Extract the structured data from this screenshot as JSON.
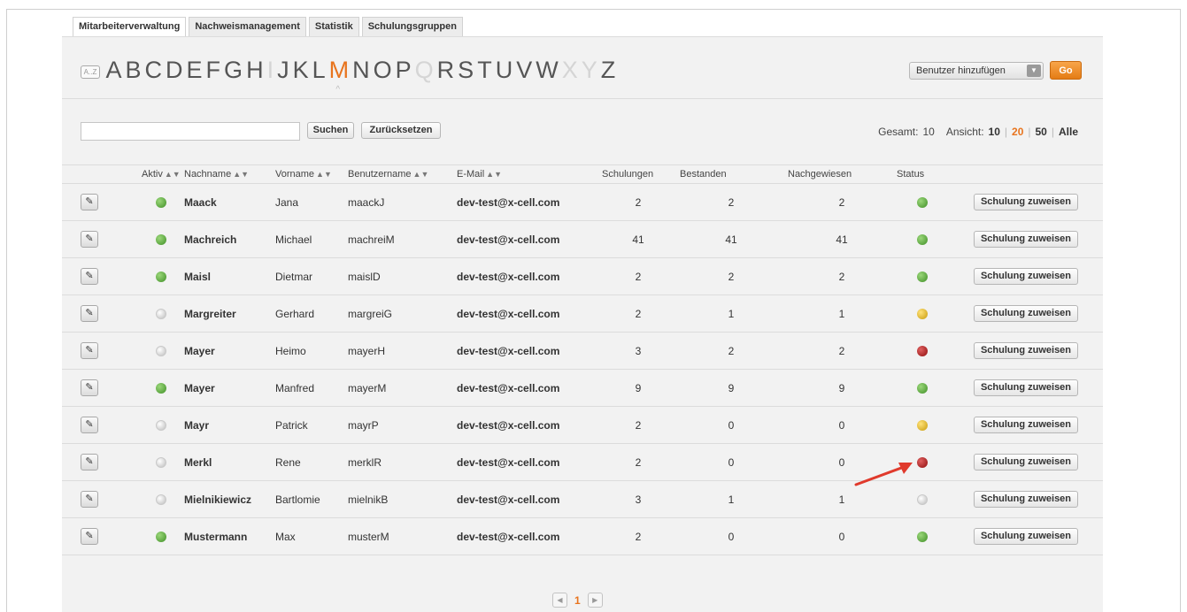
{
  "tabs": [
    "Mitarbeiterverwaltung",
    "Nachweismanagement",
    "Statistik",
    "Schulungsgruppen"
  ],
  "alphabet": {
    "az_icon": "A..Z",
    "letters": [
      {
        "l": "A",
        "state": "normal"
      },
      {
        "l": "B",
        "state": "normal"
      },
      {
        "l": "C",
        "state": "normal"
      },
      {
        "l": "D",
        "state": "normal"
      },
      {
        "l": "E",
        "state": "normal"
      },
      {
        "l": "F",
        "state": "normal"
      },
      {
        "l": "G",
        "state": "normal"
      },
      {
        "l": "H",
        "state": "normal"
      },
      {
        "l": "I",
        "state": "dim"
      },
      {
        "l": "J",
        "state": "normal"
      },
      {
        "l": "K",
        "state": "normal"
      },
      {
        "l": "L",
        "state": "normal"
      },
      {
        "l": "M",
        "state": "selected"
      },
      {
        "l": "N",
        "state": "normal"
      },
      {
        "l": "O",
        "state": "normal"
      },
      {
        "l": "P",
        "state": "normal"
      },
      {
        "l": "Q",
        "state": "dim"
      },
      {
        "l": "R",
        "state": "normal"
      },
      {
        "l": "S",
        "state": "normal"
      },
      {
        "l": "T",
        "state": "normal"
      },
      {
        "l": "U",
        "state": "normal"
      },
      {
        "l": "V",
        "state": "normal"
      },
      {
        "l": "W",
        "state": "normal"
      },
      {
        "l": "X",
        "state": "dim"
      },
      {
        "l": "Y",
        "state": "dim"
      },
      {
        "l": "Z",
        "state": "normal"
      }
    ]
  },
  "actions": {
    "add_user_select": "Benutzer hinzufügen",
    "go_label": "Go"
  },
  "search": {
    "placeholder": "",
    "search_label": "Suchen",
    "reset_label": "Zurücksetzen"
  },
  "paging": {
    "total_label": "Gesamt:",
    "total": "10",
    "view_label": "Ansicht:",
    "options": [
      "10",
      "20",
      "50",
      "Alle"
    ],
    "current": "20"
  },
  "columns": {
    "aktiv": "Aktiv",
    "nachname": "Nachname",
    "vorname": "Vorname",
    "benutzername": "Benutzername",
    "email": "E-Mail",
    "schulungen": "Schulungen",
    "bestanden": "Bestanden",
    "nachgewiesen": "Nachgewiesen",
    "status": "Status"
  },
  "rows": [
    {
      "aktiv": "green",
      "nachname": "Maack",
      "vorname": "Jana",
      "benutzername": "maackJ",
      "email": "dev-test@x-cell.com",
      "schulungen": "2",
      "bestanden": "2",
      "nachgewiesen": "2",
      "status": "green"
    },
    {
      "aktiv": "green",
      "nachname": "Machreich",
      "vorname": "Michael",
      "benutzername": "machreiM",
      "email": "dev-test@x-cell.com",
      "schulungen": "41",
      "bestanden": "41",
      "nachgewiesen": "41",
      "status": "green"
    },
    {
      "aktiv": "green",
      "nachname": "Maisl",
      "vorname": "Dietmar",
      "benutzername": "maislD",
      "email": "dev-test@x-cell.com",
      "schulungen": "2",
      "bestanden": "2",
      "nachgewiesen": "2",
      "status": "green"
    },
    {
      "aktiv": "grey",
      "nachname": "Margreiter",
      "vorname": "Gerhard",
      "benutzername": "margreiG",
      "email": "dev-test@x-cell.com",
      "schulungen": "2",
      "bestanden": "1",
      "nachgewiesen": "1",
      "status": "yellow"
    },
    {
      "aktiv": "grey",
      "nachname": "Mayer",
      "vorname": "Heimo",
      "benutzername": "mayerH",
      "email": "dev-test@x-cell.com",
      "schulungen": "3",
      "bestanden": "2",
      "nachgewiesen": "2",
      "status": "red"
    },
    {
      "aktiv": "green",
      "nachname": "Mayer",
      "vorname": "Manfred",
      "benutzername": "mayerM",
      "email": "dev-test@x-cell.com",
      "schulungen": "9",
      "bestanden": "9",
      "nachgewiesen": "9",
      "status": "green"
    },
    {
      "aktiv": "grey",
      "nachname": "Mayr",
      "vorname": "Patrick",
      "benutzername": "mayrP",
      "email": "dev-test@x-cell.com",
      "schulungen": "2",
      "bestanden": "0",
      "nachgewiesen": "0",
      "status": "yellow"
    },
    {
      "aktiv": "grey",
      "nachname": "Merkl",
      "vorname": "Rene",
      "benutzername": "merklR",
      "email": "dev-test@x-cell.com",
      "schulungen": "2",
      "bestanden": "0",
      "nachgewiesen": "0",
      "status": "red"
    },
    {
      "aktiv": "grey",
      "nachname": "Mielnikiewicz",
      "vorname": "Bartlomie",
      "benutzername": "mielnikB",
      "email": "dev-test@x-cell.com",
      "schulungen": "3",
      "bestanden": "1",
      "nachgewiesen": "1",
      "status": "grey"
    },
    {
      "aktiv": "green",
      "nachname": "Mustermann",
      "vorname": "Max",
      "benutzername": "musterM",
      "email": "dev-test@x-cell.com",
      "schulungen": "2",
      "bestanden": "0",
      "nachgewiesen": "0",
      "status": "green"
    }
  ],
  "row_action_label": "Schulung zuweisen",
  "pager": {
    "current_page": "1"
  },
  "colors": {
    "accent": "#e8741e",
    "green": "#4a9a2e",
    "yellow": "#d4a514",
    "red": "#9e1414",
    "grey": "#cfcfcf",
    "arrow": "#e03a2c"
  },
  "icons": {
    "edit": "pencil-icon",
    "sort": "sort-icon",
    "prev": "prev-page-icon",
    "next": "next-page-icon",
    "dropdown": "chevron-down-icon"
  }
}
